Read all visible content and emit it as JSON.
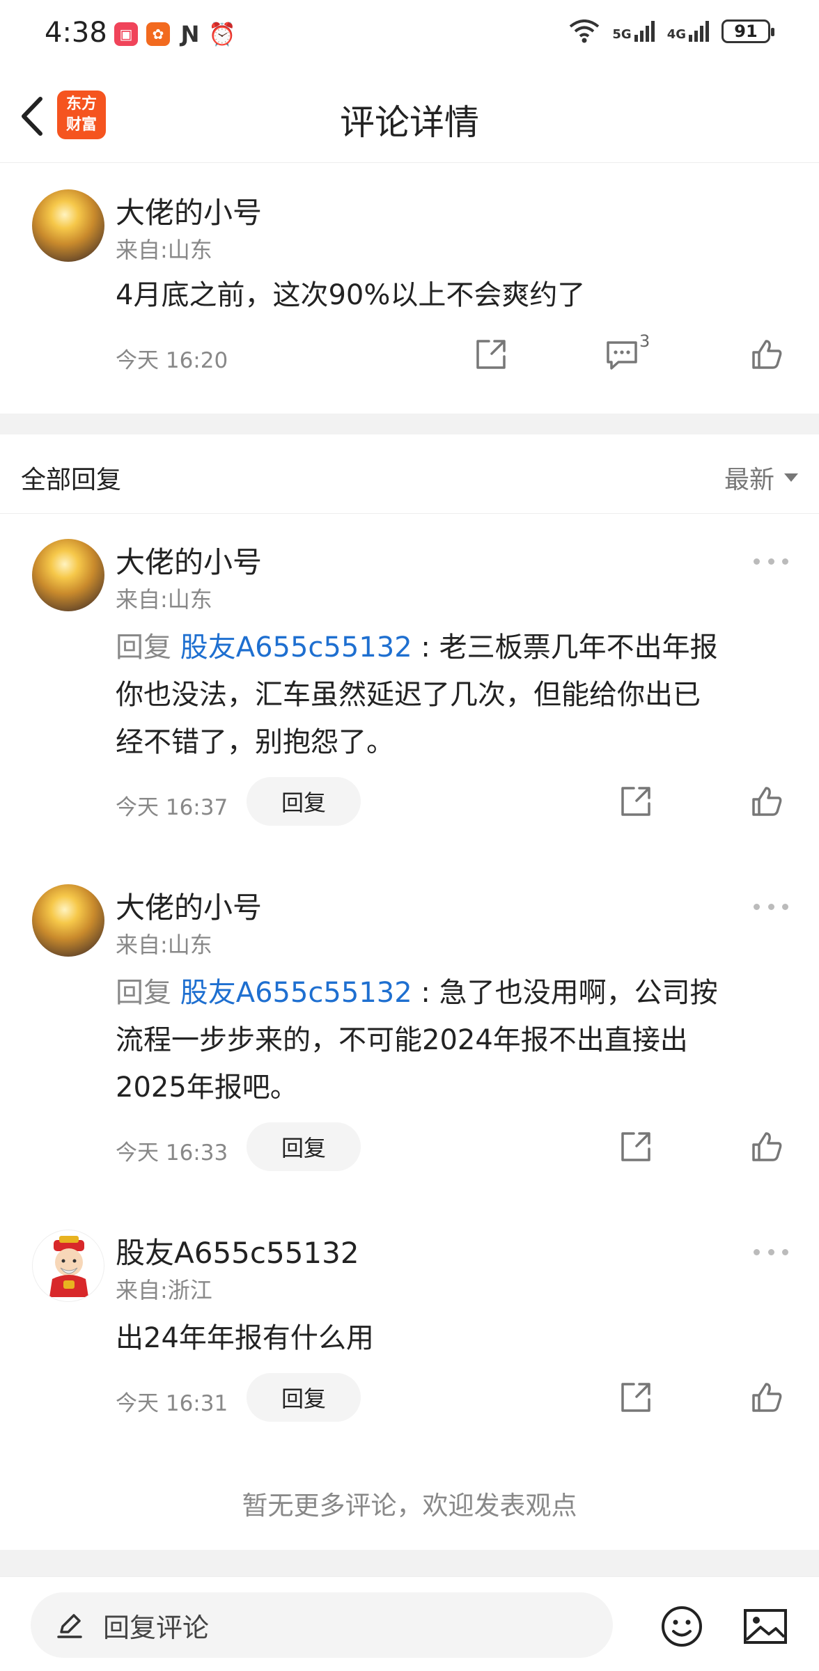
{
  "status_bar": {
    "time": "4:38",
    "network_1": "5G",
    "network_2": "4G",
    "battery": "91",
    "app_icons": [
      "red-app-icon",
      "orange-app-icon",
      "nfc-icon",
      "alarm-icon"
    ]
  },
  "header": {
    "title": "评论详情",
    "logo_line1": "东方",
    "logo_line2": "财富",
    "logo_color": "#f5541f"
  },
  "main_comment": {
    "author": "大佬的小号",
    "location": "来自:山东",
    "text": "4月底之前，这次90%以上不会爽约了",
    "time": "今天 16:20",
    "reply_count": "3"
  },
  "replies_section": {
    "title": "全部回复",
    "sort_label": "最新"
  },
  "replies": [
    {
      "author": "大佬的小号",
      "location": "来自:山东",
      "prefix": "回复",
      "mention": "股友A655c55132",
      "line1": " : 老三板票几年不出年报",
      "line2": "你也没法，汇车虽然延迟了几次，但能给你出已",
      "line3": "经不错了，别抱怨了。",
      "time": "今天 16:37",
      "reply_label": "回复"
    },
    {
      "author": "大佬的小号",
      "location": "来自:山东",
      "prefix": "回复",
      "mention": "股友A655c55132",
      "line1": " : 急了也没用啊，公司按",
      "line2": "流程一步步来的，不可能2024年报不出直接出",
      "line3": "2025年报吧。",
      "time": "今天 16:33",
      "reply_label": "回复"
    },
    {
      "author": "股友A655c55132",
      "location": "来自:浙江",
      "text": "出24年年报有什么用",
      "time": "今天 16:31",
      "reply_label": "回复"
    }
  ],
  "footer": {
    "no_more_text": "暂无更多评论，欢迎发表观点",
    "input_placeholder": "回复评论"
  },
  "colors": {
    "accent_link": "#1e6fd0",
    "muted_text": "#888888",
    "divider": "#f2f2f2"
  }
}
